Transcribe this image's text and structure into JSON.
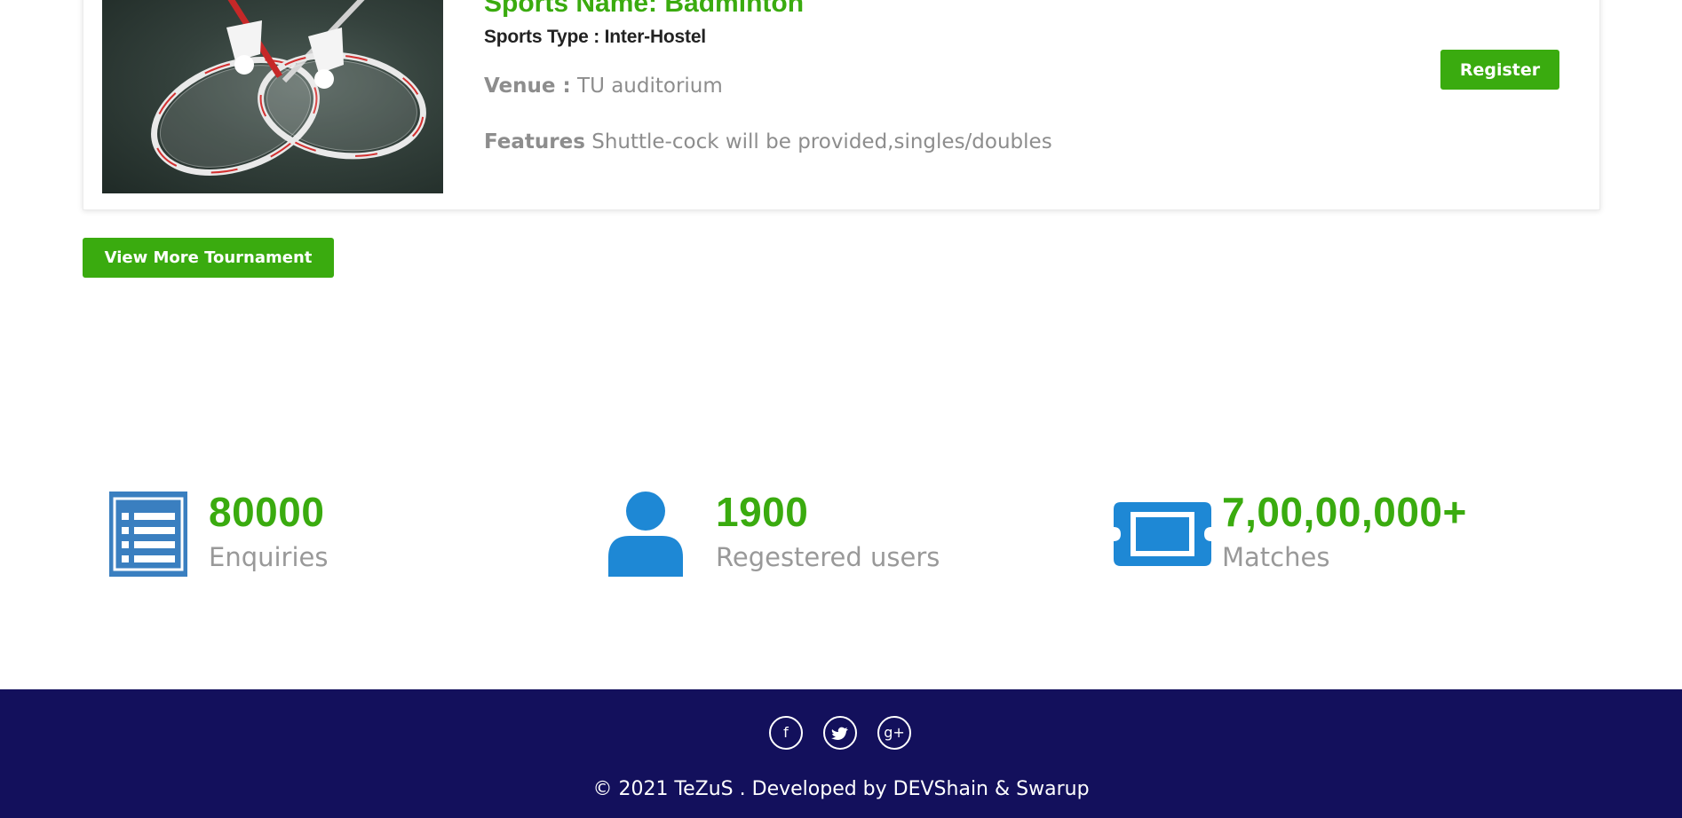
{
  "tournament": {
    "name": "Sports Name: Badminton",
    "type": "Sports Type : Inter-Hostel",
    "venue_label": "Venue :",
    "venue_value": "TU auditorium",
    "features_label": "Features",
    "features_value": "Shuttle-cock will be provided,singles/doubles",
    "register_label": "Register",
    "image_icon": "badminton-rackets-photo"
  },
  "view_more_label": "View More Tournament",
  "stats": [
    {
      "value": "80000",
      "label": "Enquiries",
      "icon": "list-icon"
    },
    {
      "value": "1900",
      "label": "Regestered users",
      "icon": "user-icon"
    },
    {
      "value": "7,00,00,000+",
      "label": "Matches",
      "icon": "ticket-icon"
    }
  ],
  "footer": {
    "social": [
      "facebook-icon",
      "twitter-icon",
      "google-plus-icon"
    ],
    "copyright": "© 2021 TeZuS . Developed by DEVShain & Swarup"
  },
  "colors": {
    "accent_green": "#3aab0f",
    "icon_blue": "#1e88d5",
    "footer_bg": "#13105c",
    "muted_text": "#8d8d8d"
  }
}
